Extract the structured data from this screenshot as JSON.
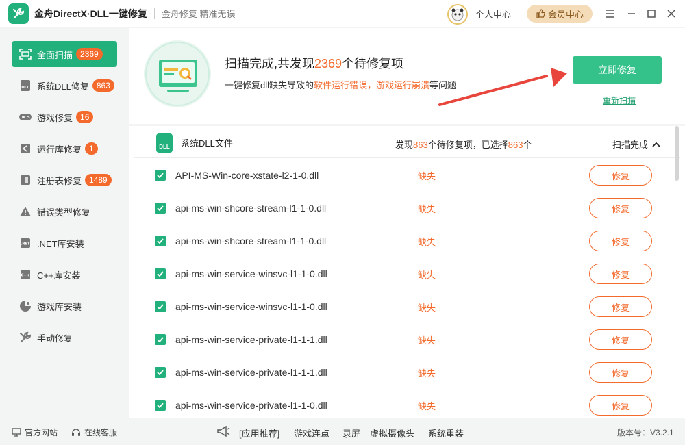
{
  "titlebar": {
    "app_title": "金舟DirectX·DLL一键修复",
    "slogan": "金舟修复 精准无误",
    "user_center": "个人中心",
    "vip_label": "会员中心"
  },
  "sidebar": {
    "items": [
      {
        "label": "全面扫描",
        "badge": "2369",
        "icon": "scan-icon"
      },
      {
        "label": "系统DLL修复",
        "badge": "863",
        "icon": "dll-icon"
      },
      {
        "label": "游戏修复",
        "badge": "16",
        "icon": "gamepad-icon"
      },
      {
        "label": "运行库修复",
        "badge": "1",
        "icon": "runtime-icon"
      },
      {
        "label": "注册表修复",
        "badge": "1489",
        "icon": "registry-icon"
      },
      {
        "label": "错误类型修复",
        "badge": "",
        "icon": "warning-icon"
      },
      {
        "label": ".NET库安装",
        "badge": "",
        "icon": "dotnet-icon"
      },
      {
        "label": "C++库安装",
        "badge": "",
        "icon": "cpp-icon"
      },
      {
        "label": "游戏库安装",
        "badge": "",
        "icon": "game-lib-icon"
      },
      {
        "label": "手动修复",
        "badge": "",
        "icon": "tools-icon"
      }
    ]
  },
  "hero": {
    "title_prefix": "扫描完成,共发现",
    "title_count": "2369",
    "title_suffix": "个待修复项",
    "sub_prefix": "一键修复dll缺失导致的",
    "sub_warn": "软件运行错误，游戏运行崩溃",
    "sub_suffix": "等问题",
    "fix_now_label": "立即修复",
    "rescan_label": "重新扫描"
  },
  "list": {
    "header_title": "系统DLL文件",
    "found_prefix": "发现",
    "found_count": "863",
    "found_mid": "个待修复项，已选择",
    "selected_count": "863",
    "found_suffix": "个",
    "scan_status": "扫描完成",
    "rows": [
      {
        "name": "API-MS-Win-core-xstate-l2-1-0.dll",
        "status": "缺失",
        "action": "修复"
      },
      {
        "name": "api-ms-win-shcore-stream-l1-1-0.dll",
        "status": "缺失",
        "action": "修复"
      },
      {
        "name": "api-ms-win-shcore-stream-l1-1-0.dll",
        "status": "缺失",
        "action": "修复"
      },
      {
        "name": "api-ms-win-service-winsvc-l1-1-0.dll",
        "status": "缺失",
        "action": "修复"
      },
      {
        "name": "api-ms-win-service-winsvc-l1-1-0.dll",
        "status": "缺失",
        "action": "修复"
      },
      {
        "name": "api-ms-win-service-private-l1-1-1.dll",
        "status": "缺失",
        "action": "修复"
      },
      {
        "name": "api-ms-win-service-private-l1-1-1.dll",
        "status": "缺失",
        "action": "修复"
      },
      {
        "name": "api-ms-win-service-private-l1-1-0.dll",
        "status": "缺失",
        "action": "修复"
      }
    ]
  },
  "footer": {
    "website": "官方网站",
    "support": "在线客服",
    "apps": [
      "[应用推荐]",
      "游戏连点",
      "录屏",
      "虚拟摄像头",
      "系统重装"
    ],
    "version": "版本号：V3.2.1"
  },
  "colors": {
    "accent": "#22b07d",
    "warning": "#f36a2c",
    "vip": "#f5dcb9"
  }
}
